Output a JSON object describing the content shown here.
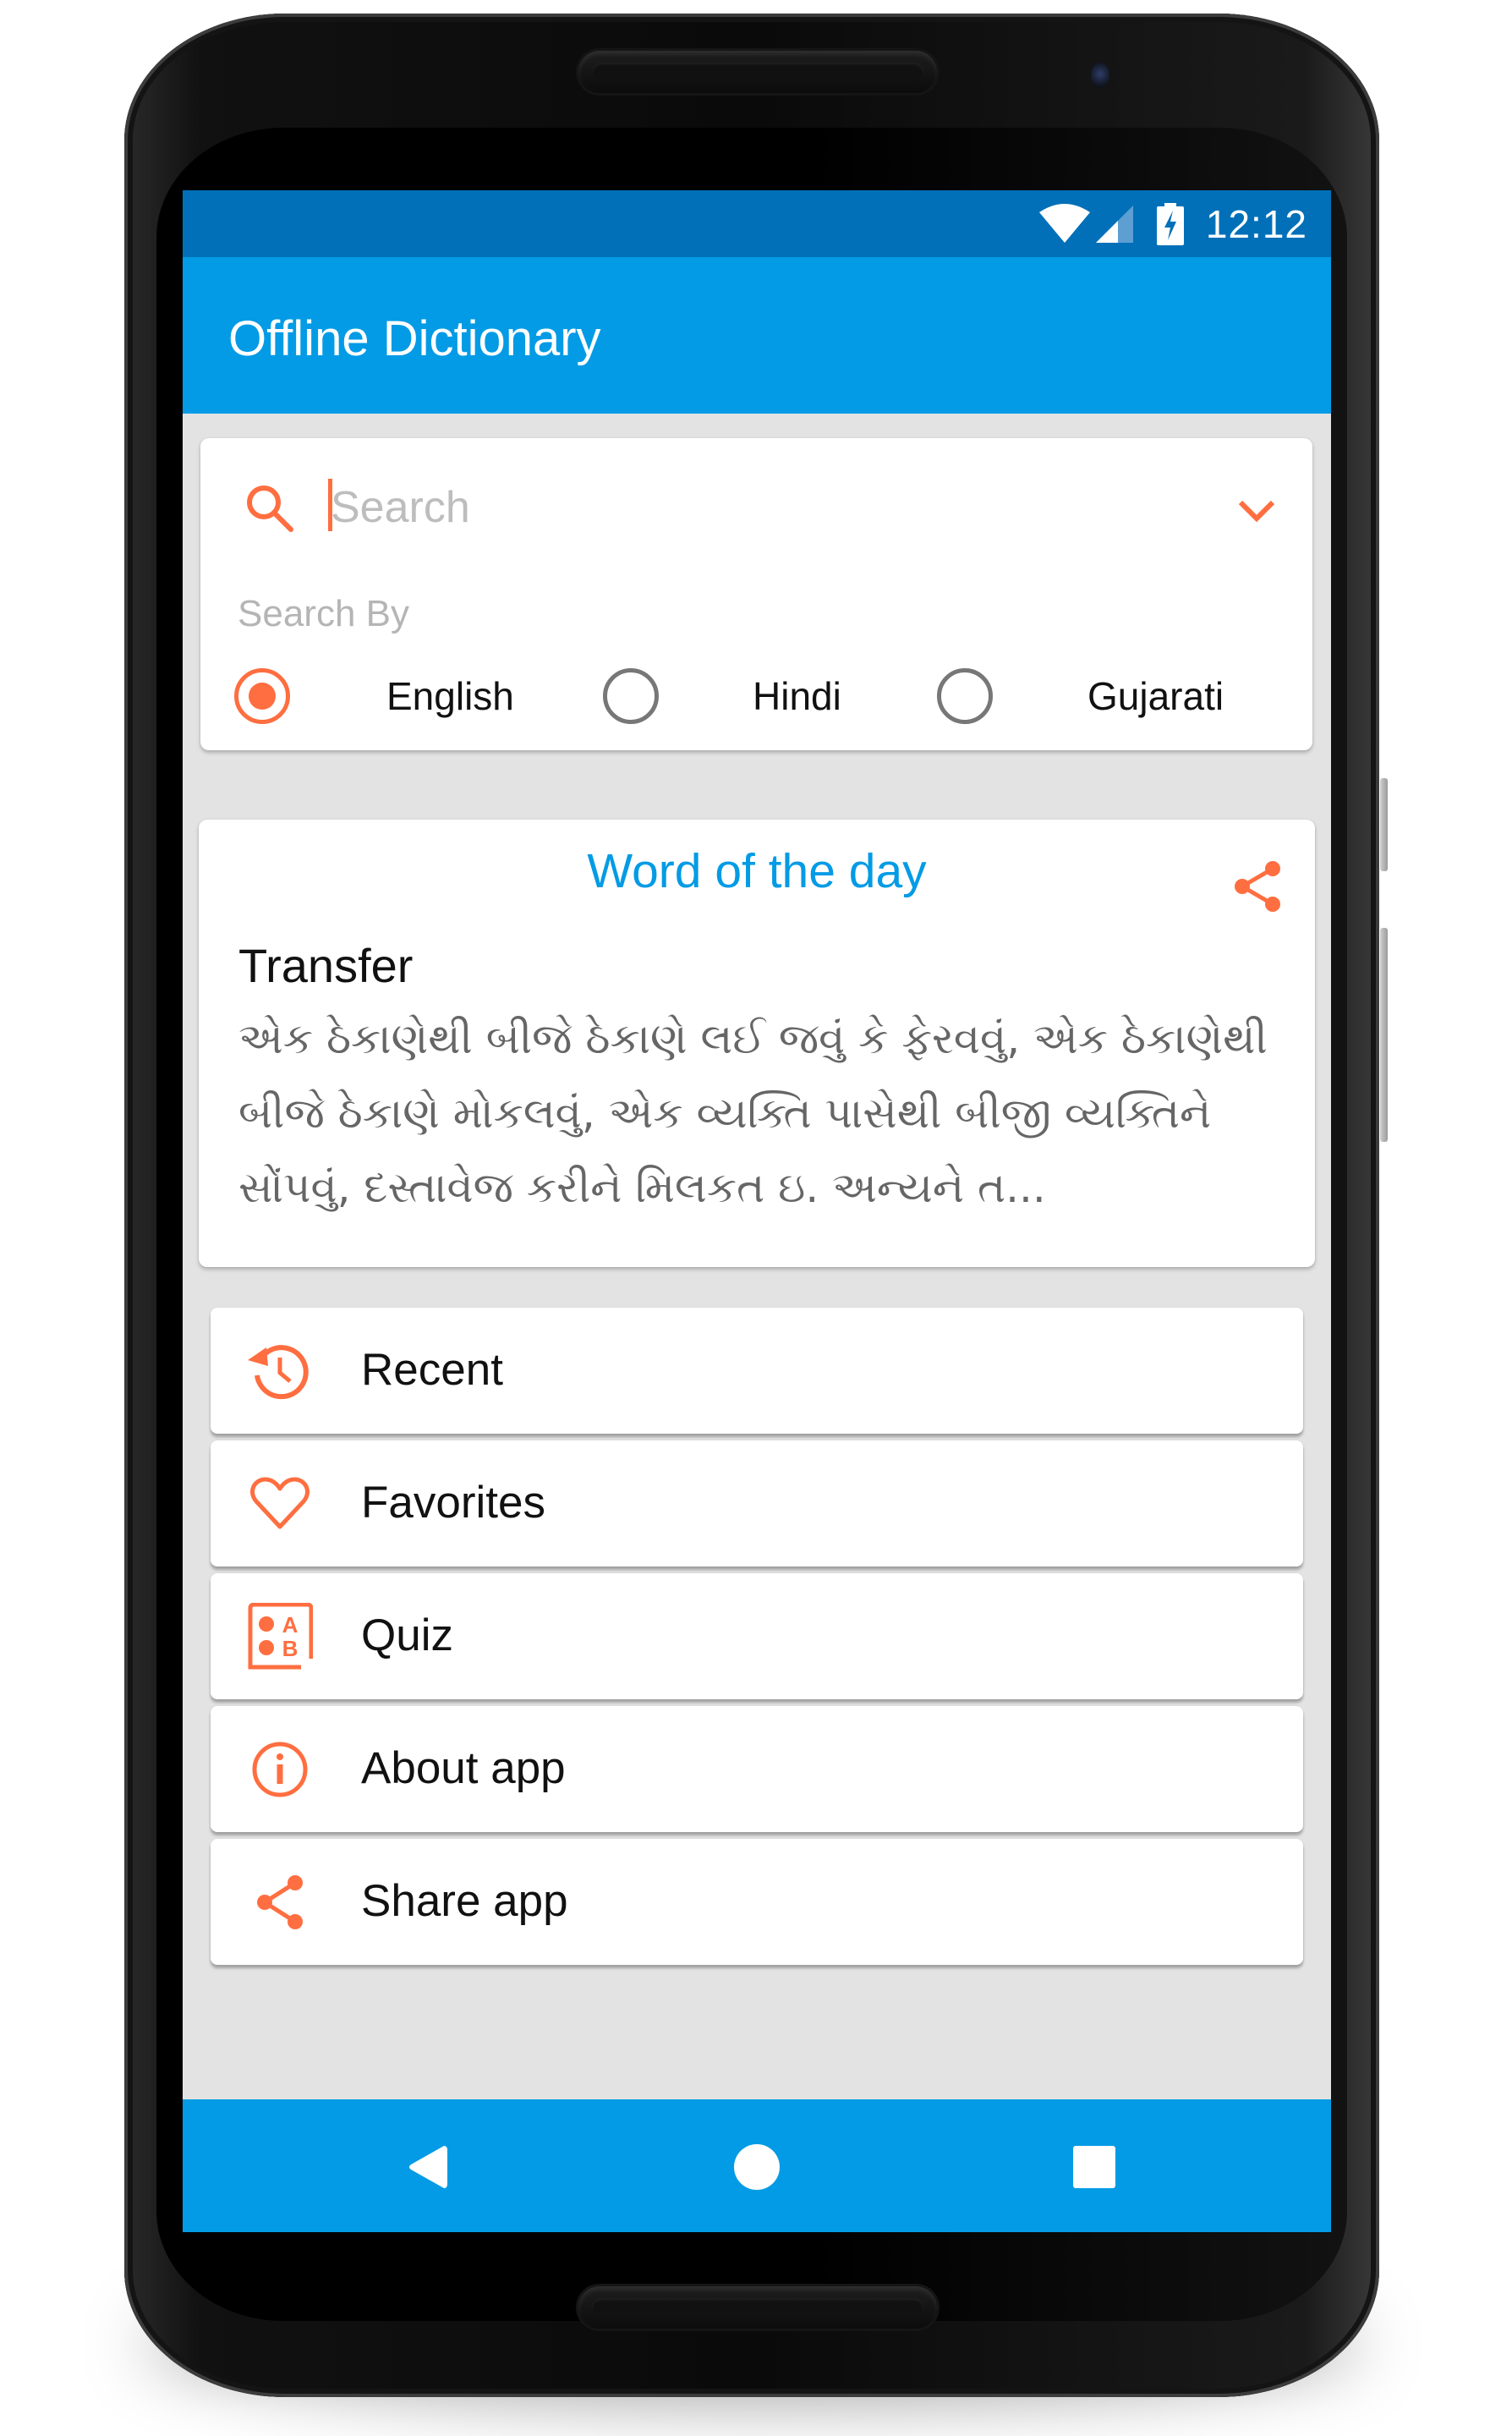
{
  "status_bar": {
    "time": "12:12",
    "icons": [
      "wifi-icon",
      "cell-signal-icon",
      "battery-charging-icon"
    ]
  },
  "app_bar": {
    "title": "Offline Dictionary"
  },
  "search": {
    "value": "",
    "placeholder": "Search",
    "icon": "search-icon",
    "dropdown_icon": "chevron-down-icon",
    "search_by_label": "Search By",
    "options": [
      {
        "label": "English",
        "selected": true
      },
      {
        "label": "Hindi",
        "selected": false
      },
      {
        "label": "Gujarati",
        "selected": false
      }
    ]
  },
  "word_of_day": {
    "title": "Word of the day",
    "share_icon": "share-icon",
    "term": "Transfer",
    "meaning": "એક ઠેકાણેથી બીજે ઠેકાણે લઈ જવું કે ફેરવવું, એક ઠેકાણેથી બીજે ઠેકાણે મોકલવું, એક વ્યક્તિ પાસેથી બીજી વ્યક્તિને સોંપવું, દસ્તાવેજ કરીને મિલકત ઇ. અન્યને ત..."
  },
  "menu": [
    {
      "label": "Recent",
      "icon": "history-icon"
    },
    {
      "label": "Favorites",
      "icon": "heart-icon"
    },
    {
      "label": "Quiz",
      "icon": "quiz-icon"
    },
    {
      "label": "About app",
      "icon": "info-icon"
    },
    {
      "label": "Share app",
      "icon": "share-icon"
    }
  ],
  "nav_bar": {
    "buttons": [
      "back-icon",
      "home-icon",
      "recents-icon"
    ]
  },
  "colors": {
    "status_bar": "#0270b8",
    "app_bar": "#039be5",
    "accent": "#ff6e40",
    "background": "#e3e3e3",
    "meaning_text": "#666666"
  }
}
